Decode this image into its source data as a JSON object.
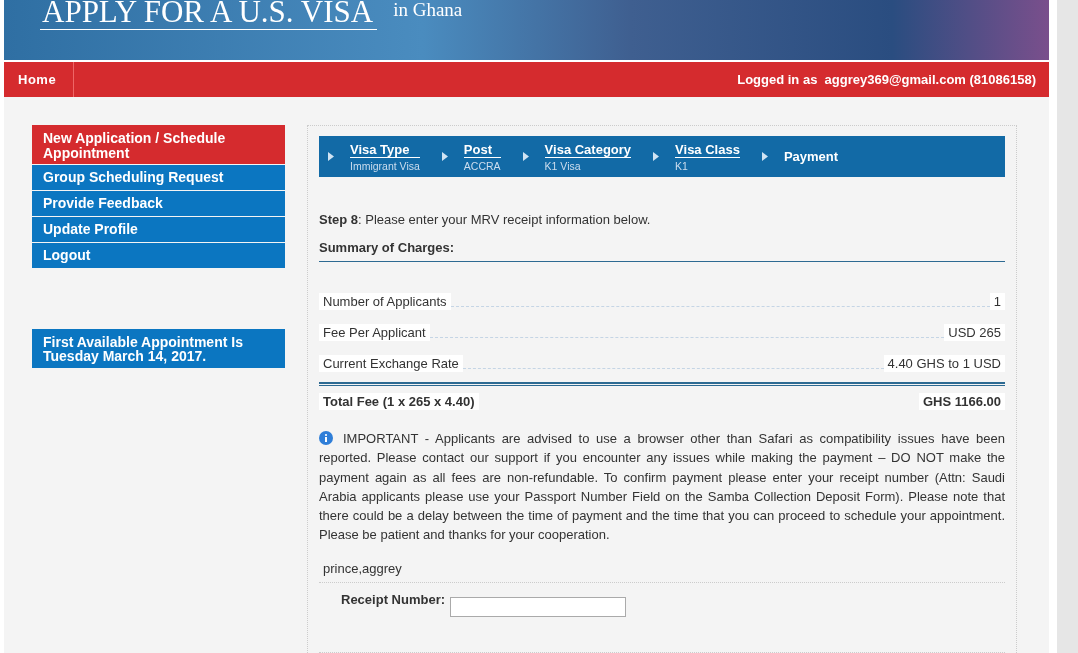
{
  "header": {
    "title": "APPLY FOR A U.S. VISA",
    "subtitle": "in  Ghana"
  },
  "nav": {
    "home": "Home",
    "logged_in_label": "Logged in as",
    "account": "aggrey369@gmail.com (81086158)"
  },
  "sidebar": {
    "items": [
      {
        "label": "New Application / Schedule Appointment",
        "selected": true
      },
      {
        "label": "Group Scheduling Request",
        "selected": false
      },
      {
        "label": "Provide Feedback",
        "selected": false
      },
      {
        "label": "Update Profile",
        "selected": false
      },
      {
        "label": "Logout",
        "selected": false
      }
    ],
    "notice": "First Available Appointment Is Tuesday March 14, 2017."
  },
  "steps": [
    {
      "kind": "done",
      "title": "Visa Type",
      "value": "Immigrant Visa"
    },
    {
      "kind": "done",
      "title": "Post",
      "value": "ACCRA"
    },
    {
      "kind": "done",
      "title": "Visa Category",
      "value": "K1 Visa"
    },
    {
      "kind": "done",
      "title": "Visa Class",
      "value": "K1"
    },
    {
      "kind": "current",
      "title": "Payment"
    }
  ],
  "instruction": "**Step 8**: Please enter your MRV receipt information below.",
  "summary": {
    "title": "Summary of Charges:",
    "rows": [
      {
        "label": "Number of Applicants",
        "value": "1"
      },
      {
        "label": "Fee Per Applicant",
        "value": "USD 265"
      },
      {
        "label": "Current Exchange Rate",
        "value": "4.40 GHS to 1 USD"
      }
    ],
    "total": {
      "label": "Total Fee (1 x 265 x 4.40)",
      "value": "GHS 1166.00"
    }
  },
  "important": "IMPORTANT - Applicants are advised to use a browser other than Safari as compatibility issues have been reported. Please contact our support if you encounter any issues while making the payment – DO NOT make the payment again as all fees are non-refundable. To confirm payment please enter your receipt number (Attn: Saudi Arabia applicants please use your Passport Number Field on the Samba Collection Deposit Form). Please note that there could be a delay between the time of payment and the time that you can proceed to schedule your appointment. Please be patient and thanks for your cooperation.",
  "applicant_name": "prince,aggrey",
  "receipt": {
    "label": "Receipt Number:"
  }
}
